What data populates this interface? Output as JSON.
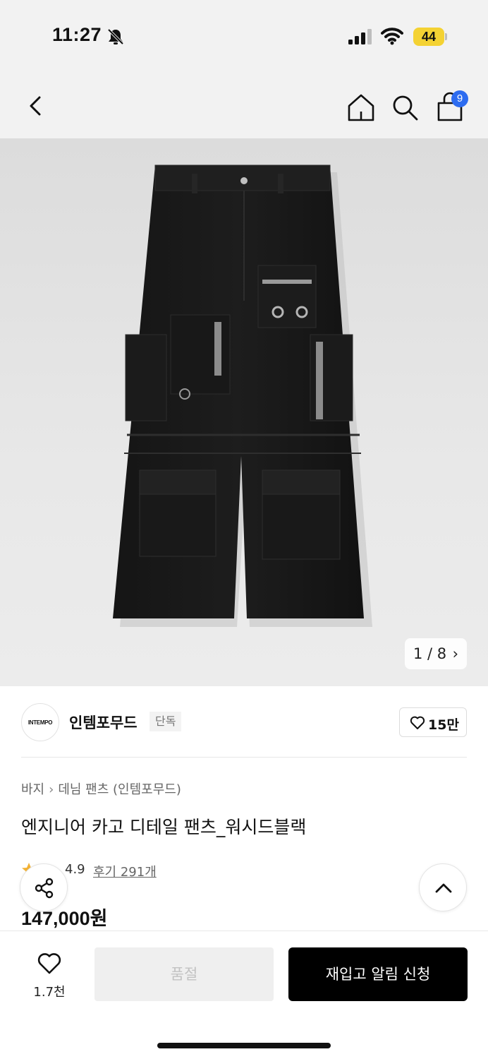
{
  "status_bar": {
    "time": "11:27",
    "battery": "44"
  },
  "nav": {
    "cart_count": "9"
  },
  "gallery": {
    "counter": "1 / 8",
    "counter_arrow": "›"
  },
  "brand": {
    "logo_text": "INTEMPO",
    "name": "인템포무드",
    "tag": "단독",
    "likes": "15만"
  },
  "breadcrumb": [
    "바지",
    "데님 팬츠 (인템포무드)"
  ],
  "breadcrumb_sep": "›",
  "product": {
    "title": "엔지니어 카고 디테일 팬츠_워시드블랙",
    "rating": "4.9",
    "reviews": "후기 291개",
    "price": "147,000원"
  },
  "bottom_bar": {
    "wish_count": "1.7천",
    "soldout_label": "품절",
    "restock_label": "재입고 알림 신청"
  },
  "colors": {
    "accent_badge": "#2d6cf0",
    "primary_button": "#000000",
    "disabled_button": "#efefef",
    "star": "#f3b234"
  }
}
